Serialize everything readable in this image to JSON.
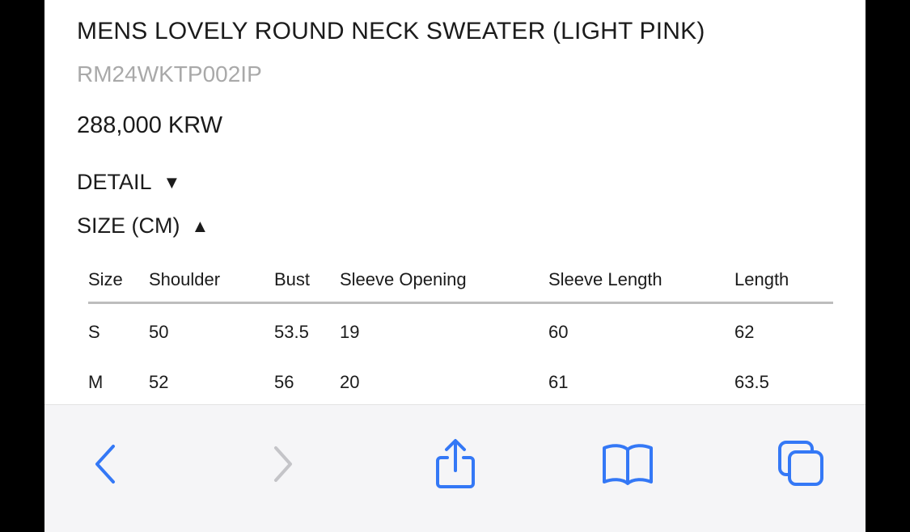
{
  "product": {
    "title": "MENS LOVELY ROUND NECK SWEATER (LIGHT PINK)",
    "sku": "RM24WKTP002IP",
    "price": "288,000 KRW"
  },
  "sections": {
    "detail_label": "DETAIL",
    "detail_arrow": "▼",
    "size_label": "SIZE (CM)",
    "size_arrow": "▲"
  },
  "size_table": {
    "headers": [
      "Size",
      "Shoulder",
      "Bust",
      "Sleeve Opening",
      "Sleeve Length",
      "Length"
    ],
    "rows": [
      [
        "S",
        "50",
        "53.5",
        "19",
        "60",
        "62"
      ],
      [
        "M",
        "52",
        "56",
        "20",
        "61",
        "63.5"
      ]
    ]
  },
  "toolbar": {
    "icons": [
      "back-icon",
      "forward-icon",
      "share-icon",
      "bookmarks-icon",
      "tabs-icon"
    ],
    "accent": "#3478f6",
    "disabled": "#c4c4c8"
  }
}
